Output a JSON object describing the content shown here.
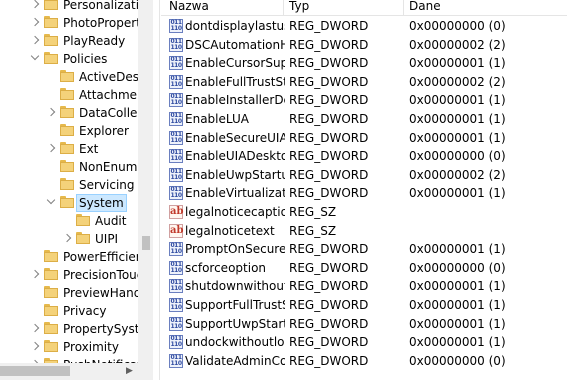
{
  "tree": {
    "items": [
      {
        "label": "Personalization",
        "level": 1,
        "expander": "right",
        "selected": false
      },
      {
        "label": "PhotoPropertyHandler",
        "level": 1,
        "expander": "right",
        "selected": false
      },
      {
        "label": "PlayReady",
        "level": 1,
        "expander": "right",
        "selected": false
      },
      {
        "label": "Policies",
        "level": 1,
        "expander": "down",
        "selected": false
      },
      {
        "label": "ActiveDesktop",
        "level": 2,
        "expander": "none",
        "selected": false
      },
      {
        "label": "Attachments",
        "level": 2,
        "expander": "none",
        "selected": false
      },
      {
        "label": "DataCollection",
        "level": 2,
        "expander": "right",
        "selected": false
      },
      {
        "label": "Explorer",
        "level": 2,
        "expander": "none",
        "selected": false
      },
      {
        "label": "Ext",
        "level": 2,
        "expander": "right",
        "selected": false
      },
      {
        "label": "NonEnum",
        "level": 2,
        "expander": "none",
        "selected": false
      },
      {
        "label": "Servicing",
        "level": 2,
        "expander": "none",
        "selected": false
      },
      {
        "label": "System",
        "level": 2,
        "expander": "down",
        "selected": true
      },
      {
        "label": "Audit",
        "level": 3,
        "expander": "none",
        "selected": false
      },
      {
        "label": "UIPI",
        "level": 3,
        "expander": "right",
        "selected": false
      },
      {
        "label": "PowerEfficiencyDiagnostics",
        "level": 1,
        "expander": "none",
        "selected": false
      },
      {
        "label": "PrecisionTouchPad",
        "level": 1,
        "expander": "right",
        "selected": false
      },
      {
        "label": "PreviewHandlers",
        "level": 1,
        "expander": "none",
        "selected": false
      },
      {
        "label": "Privacy",
        "level": 1,
        "expander": "none",
        "selected": false
      },
      {
        "label": "PropertySystem",
        "level": 1,
        "expander": "right",
        "selected": false
      },
      {
        "label": "Proximity",
        "level": 1,
        "expander": "right",
        "selected": false
      },
      {
        "label": "PushNotifications",
        "level": 1,
        "expander": "right",
        "selected": false
      }
    ],
    "scroll_right_glyph": "▶"
  },
  "list": {
    "columns": {
      "name": "Nazwa",
      "type": "Typ",
      "data": "Dane"
    },
    "rows": [
      {
        "icon": "reg-binary-icon",
        "name": "dontdisplaylastusername",
        "type": "REG_DWORD",
        "data": "0x00000000 (0)"
      },
      {
        "icon": "reg-binary-icon",
        "name": "DSCAutomationHostEnabled",
        "type": "REG_DWORD",
        "data": "0x00000002 (2)"
      },
      {
        "icon": "reg-binary-icon",
        "name": "EnableCursorSuppression",
        "type": "REG_DWORD",
        "data": "0x00000001 (1)"
      },
      {
        "icon": "reg-binary-icon",
        "name": "EnableFullTrustStartupTasks",
        "type": "REG_DWORD",
        "data": "0x00000002 (2)"
      },
      {
        "icon": "reg-binary-icon",
        "name": "EnableInstallerDetection",
        "type": "REG_DWORD",
        "data": "0x00000001 (1)"
      },
      {
        "icon": "reg-binary-icon",
        "name": "EnableLUA",
        "type": "REG_DWORD",
        "data": "0x00000001 (1)"
      },
      {
        "icon": "reg-binary-icon",
        "name": "EnableSecureUIAPaths",
        "type": "REG_DWORD",
        "data": "0x00000001 (1)"
      },
      {
        "icon": "reg-binary-icon",
        "name": "EnableUIADesktopToggle",
        "type": "REG_DWORD",
        "data": "0x00000000 (0)"
      },
      {
        "icon": "reg-binary-icon",
        "name": "EnableUwpStartupTasks",
        "type": "REG_DWORD",
        "data": "0x00000002 (2)"
      },
      {
        "icon": "reg-binary-icon",
        "name": "EnableVirtualization",
        "type": "REG_DWORD",
        "data": "0x00000001 (1)"
      },
      {
        "icon": "reg-string-icon",
        "name": "legalnoticecaption",
        "type": "REG_SZ",
        "data": ""
      },
      {
        "icon": "reg-string-icon",
        "name": "legalnoticetext",
        "type": "REG_SZ",
        "data": ""
      },
      {
        "icon": "reg-binary-icon",
        "name": "PromptOnSecureDesktop",
        "type": "REG_DWORD",
        "data": "0x00000001 (1)"
      },
      {
        "icon": "reg-binary-icon",
        "name": "scforceoption",
        "type": "REG_DWORD",
        "data": "0x00000000 (0)"
      },
      {
        "icon": "reg-binary-icon",
        "name": "shutdownwithoutlogon",
        "type": "REG_DWORD",
        "data": "0x00000001 (1)"
      },
      {
        "icon": "reg-binary-icon",
        "name": "SupportFullTrustStartupTasks",
        "type": "REG_DWORD",
        "data": "0x00000001 (1)"
      },
      {
        "icon": "reg-binary-icon",
        "name": "SupportUwpStartupTasks",
        "type": "REG_DWORD",
        "data": "0x00000001 (1)"
      },
      {
        "icon": "reg-binary-icon",
        "name": "undockwithoutlogon",
        "type": "REG_DWORD",
        "data": "0x00000001 (1)"
      },
      {
        "icon": "reg-binary-icon",
        "name": "ValidateAdminCodeSignatures",
        "type": "REG_DWORD",
        "data": "0x00000000 (0)"
      }
    ]
  }
}
